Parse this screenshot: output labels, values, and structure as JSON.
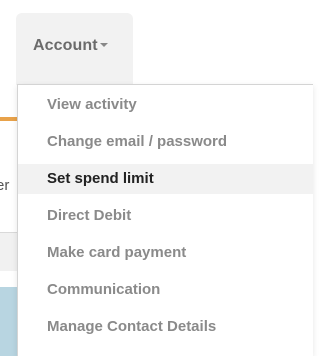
{
  "account_menu": {
    "label": "Account",
    "caret_icon": "chevron-down-icon",
    "items": [
      {
        "label": "View activity",
        "active": false
      },
      {
        "label": "Change email / password",
        "active": false
      },
      {
        "label": "Set spend limit",
        "active": true
      },
      {
        "label": "Direct Debit",
        "active": false
      },
      {
        "label": "Make card payment",
        "active": false
      },
      {
        "label": "Communication",
        "active": false
      },
      {
        "label": "Manage Contact Details",
        "active": false
      }
    ]
  },
  "background": {
    "partial_text": "er"
  },
  "colors": {
    "tab_background": "#f2f2f2",
    "item_text": "#8a8a8a",
    "active_item_text": "#222222",
    "active_item_background": "#f2f2f2",
    "accent_orange": "#e8a24a",
    "accent_blue": "#b8d5e1"
  }
}
